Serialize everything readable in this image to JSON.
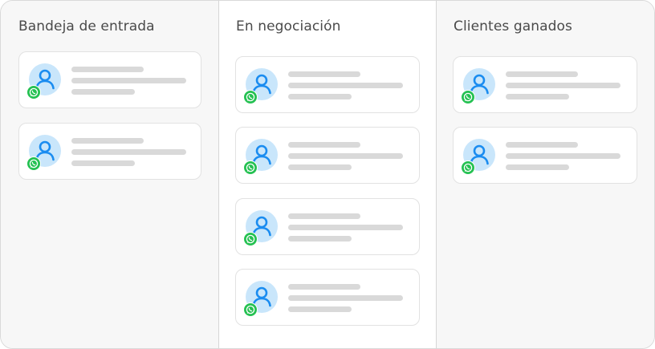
{
  "columns": [
    {
      "title": "Bandeja de entrada",
      "card_count": 2
    },
    {
      "title": "En negociación",
      "card_count": 4
    },
    {
      "title": "Clientes ganados",
      "card_count": 2
    }
  ],
  "colors": {
    "avatar_bg": "#c9e6fb",
    "avatar_icon": "#1a8cf0",
    "whatsapp": "#25c152",
    "placeholder": "#d9d9d9"
  },
  "icons": {
    "avatar": "user-icon",
    "badge": "whatsapp-icon"
  }
}
